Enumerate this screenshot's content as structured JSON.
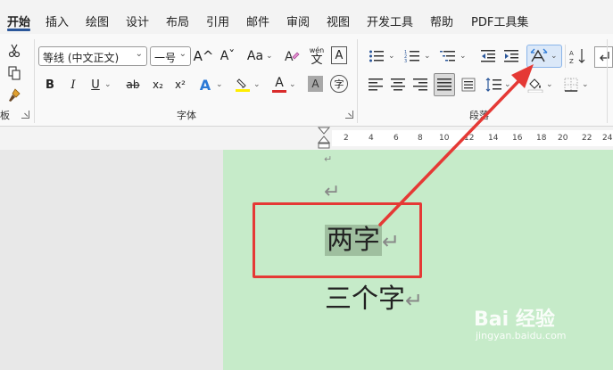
{
  "tabs": [
    {
      "label": "开始",
      "active": true
    },
    {
      "label": "插入"
    },
    {
      "label": "绘图"
    },
    {
      "label": "设计"
    },
    {
      "label": "布局"
    },
    {
      "label": "引用"
    },
    {
      "label": "邮件"
    },
    {
      "label": "审阅"
    },
    {
      "label": "视图"
    },
    {
      "label": "开发工具"
    },
    {
      "label": "帮助"
    },
    {
      "label": "PDF工具集"
    }
  ],
  "ribbon": {
    "clipboard_label_fragment": "板",
    "font_group_label": "字体",
    "paragraph_group_label": "段落",
    "font_name": "等线 (中文正文)",
    "font_size": "一号",
    "grow_font": "A^",
    "shrink_font": "Aˇ",
    "change_case": "Aa",
    "phonetic_top": "wén",
    "phonetic_bottom": "文",
    "char_border": "A",
    "bold": "B",
    "italic": "I",
    "underline": "U",
    "strike": "ab",
    "subscript": "x₂",
    "superscript": "x²",
    "text_effects": "A",
    "font_color": "A",
    "char_shading": "A",
    "enclose_char": "字",
    "colors": {
      "highlight": "#ffee00",
      "font_color": "#d92b2b",
      "accent": "#2b579a",
      "selection": "#9fbf9f",
      "page": "#c6ebc9",
      "annotation": "#e53935"
    }
  },
  "ruler_numbers": [
    "2",
    "4",
    "6",
    "8",
    "10",
    "12",
    "14",
    "16",
    "18",
    "20",
    "22",
    "24"
  ],
  "document": {
    "paragraph_mark": "↵",
    "line1_selected": "两字",
    "line2": "三个字"
  },
  "watermark": {
    "main": "Bai  经验",
    "sub": "jingyan.baidu.com"
  }
}
